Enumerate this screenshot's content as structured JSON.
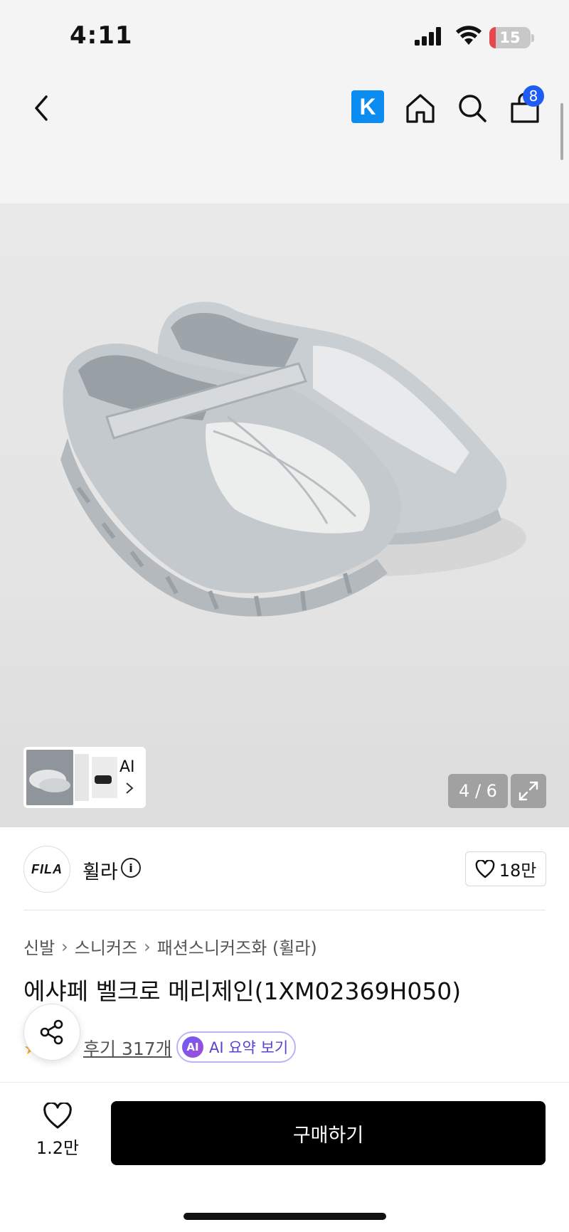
{
  "status_bar": {
    "time": "4:11",
    "battery": "15",
    "battery_level_percent": 15
  },
  "nav": {
    "back_icon": "chevron-left-icon",
    "k_logo": "K",
    "home_icon": "home-icon",
    "search_icon": "search-icon",
    "cart_icon": "shopping-bag-icon",
    "cart_badge": "8"
  },
  "gallery": {
    "thumb_label": "AI",
    "counter": "4 / 6",
    "expand_icon": "expand-icon"
  },
  "brand": {
    "logo_text": "FILA",
    "name": "휠라",
    "likes": "18만"
  },
  "breadcrumb": [
    "신발",
    "스니커즈",
    "패션스니커즈화 (휠라)"
  ],
  "product": {
    "title": "에샤페 벨크로 메리제인(1XM02369H050)",
    "reviews_link": "후기 317개",
    "ai_badge": "AI",
    "ai_summary_label": "AI 요약 보기"
  },
  "colors": {
    "accent": "#1e5cf5",
    "k_brand": "#0a8cf0",
    "ai_purple": "#5b3fd6",
    "star": "#f5a623"
  },
  "bottom_bar": {
    "wish_count": "1.2만",
    "buy_label": "구매하기"
  }
}
